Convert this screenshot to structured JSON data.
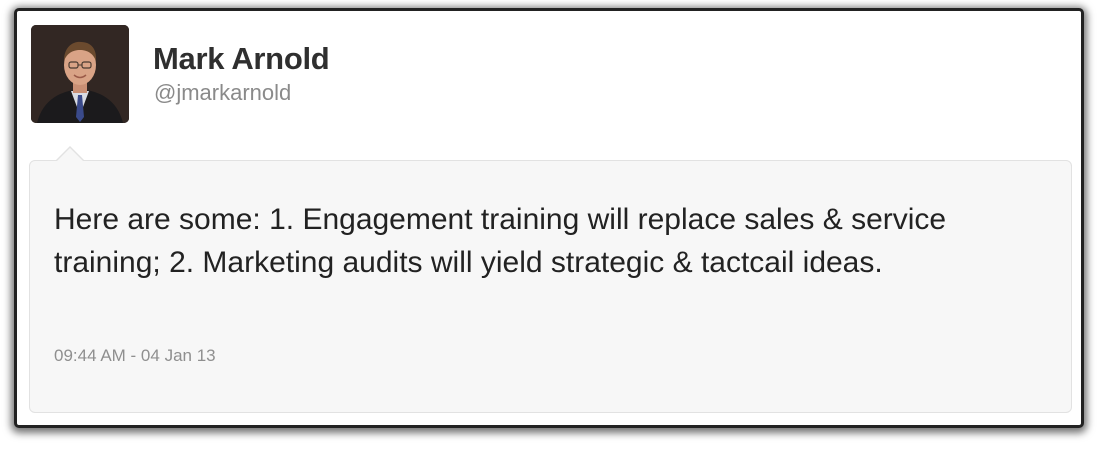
{
  "user": {
    "name": "Mark Arnold",
    "handle": "@jmarkarnold"
  },
  "tweet": {
    "text": "Here are some: 1. Engagement training will replace sales & service training; 2. Marketing audits will yield strategic & tactcail ideas.",
    "timestamp": "09:44 AM - 04 Jan 13"
  }
}
